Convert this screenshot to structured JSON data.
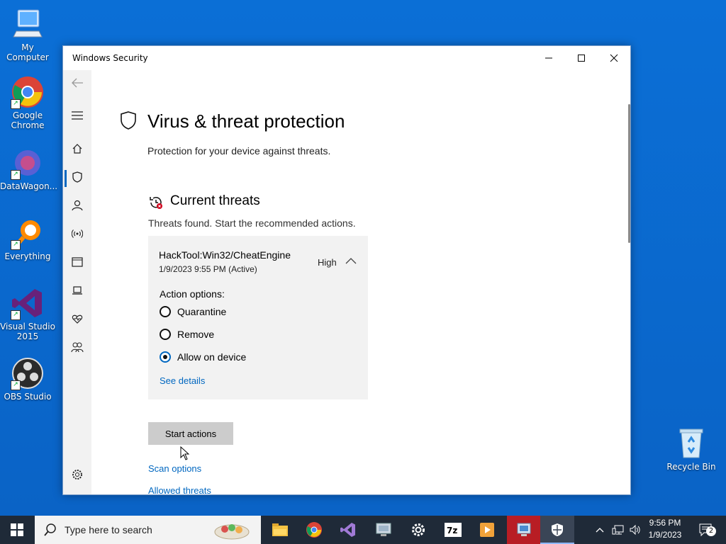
{
  "desktop": {
    "icons": [
      {
        "label": "My Computer"
      },
      {
        "label": "Google Chrome"
      },
      {
        "label": "DataWagon..."
      },
      {
        "label": "Everything"
      },
      {
        "label": "Visual Studio 2015"
      },
      {
        "label": "OBS Studio"
      },
      {
        "label": "Recycle Bin"
      }
    ]
  },
  "window": {
    "title": "Windows Security",
    "page_title": "Virus & threat protection",
    "page_subtitle": "Protection for your device against threats.",
    "section_title": "Current threats",
    "section_subtitle": "Threats found. Start the recommended actions.",
    "threat": {
      "name": "HackTool:Win32/CheatEngine",
      "date": "1/9/2023 9:55 PM (Active)",
      "severity": "High",
      "action_label": "Action options:",
      "options": [
        "Quarantine",
        "Remove",
        "Allow on device"
      ],
      "selected_option": "Allow on device",
      "details_link": "See details"
    },
    "start_button": "Start actions",
    "links": {
      "scan_options": "Scan options",
      "allowed_threats": "Allowed threats"
    }
  },
  "taskbar": {
    "search_placeholder": "Type here to search",
    "clock_time": "9:56 PM",
    "clock_date": "1/9/2023",
    "notification_count": "2",
    "pinned": [
      "file-explorer-icon",
      "chrome-icon",
      "visual-studio-icon",
      "remote-desktop-icon",
      "settings-icon",
      "7zip-icon",
      "media-player-icon",
      "task-manager-icon",
      "windows-security-icon"
    ]
  },
  "colors": {
    "accent": "#0067c0",
    "desktop": "#0a67d0",
    "taskbar": "#1f2a38",
    "rail": "#f2f2f2",
    "card": "#f2f2f2"
  }
}
